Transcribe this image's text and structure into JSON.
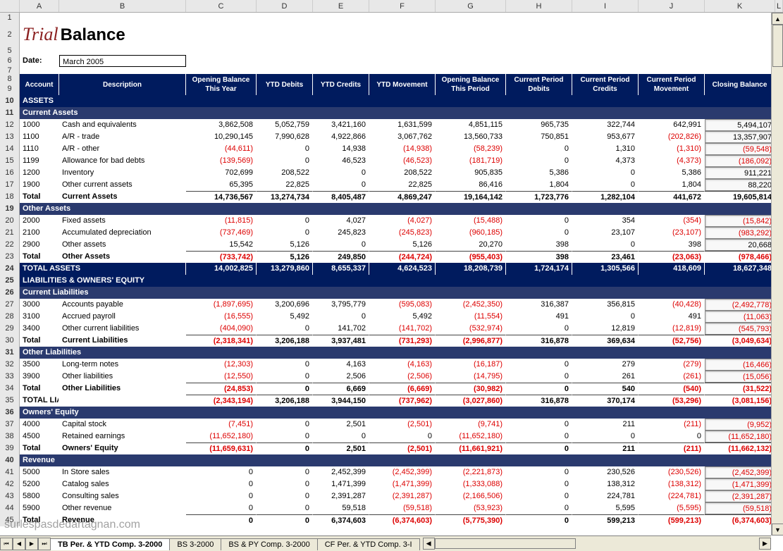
{
  "title": {
    "part1": "Trial",
    "part2": "Balance"
  },
  "date_label": "Date:",
  "date_value": "March 2005",
  "watermark": "surlespasdedartagnan.com",
  "col_letters": [
    "A",
    "B",
    "C",
    "D",
    "E",
    "F",
    "G",
    "H",
    "I",
    "J",
    "K",
    "L"
  ],
  "headers": [
    "Account",
    "Description",
    "Opening Balance This Year",
    "YTD Debits",
    "YTD Credits",
    "YTD Movement",
    "Opening Balance This Period",
    "Current Period Debits",
    "Current Period Credits",
    "Current Period Movement",
    "Closing Balance"
  ],
  "tabs": [
    "TB Per. & YTD Comp. 3-2000",
    "BS 3-2000",
    "BS & PY Comp. 3-2000",
    "CF Per. & YTD Comp. 3-I"
  ],
  "active_tab": 0,
  "sections": {
    "assets": "ASSETS",
    "current_assets": "Current Assets",
    "other_assets": "Other Assets",
    "total_assets": "TOTAL ASSETS",
    "liab_equity": "LIABILITIES & OWNERS' EQUITY",
    "current_liab": "Current Liabilities",
    "other_liab": "Other Liabilities",
    "total_liab": "TOTAL LIABILITIES",
    "owners_equity": "Owners' Equity",
    "revenue": "Revenue",
    "total_label": "Total"
  },
  "rows": [
    {
      "acct": "1000",
      "desc": "Cash and equivalents",
      "v": [
        "3,862,508",
        "5,052,759",
        "3,421,160",
        "1,631,599",
        "4,851,115",
        "965,735",
        "322,744",
        "642,991",
        "5,494,107"
      ],
      "neg": [
        0,
        0,
        0,
        0,
        0,
        0,
        0,
        0,
        0
      ],
      "box": true
    },
    {
      "acct": "1100",
      "desc": "A/R - trade",
      "v": [
        "10,290,145",
        "7,990,628",
        "4,922,866",
        "3,067,762",
        "13,560,733",
        "750,851",
        "953,677",
        "(202,826)",
        "13,357,907"
      ],
      "neg": [
        0,
        0,
        0,
        0,
        0,
        0,
        0,
        1,
        0
      ],
      "box": true
    },
    {
      "acct": "1110",
      "desc": "A/R - other",
      "v": [
        "(44,611)",
        "0",
        "14,938",
        "(14,938)",
        "(58,239)",
        "0",
        "1,310",
        "(1,310)",
        "(59,548)"
      ],
      "neg": [
        1,
        0,
        0,
        1,
        1,
        0,
        0,
        1,
        1
      ],
      "box": true
    },
    {
      "acct": "1199",
      "desc": "Allowance for bad debts",
      "v": [
        "(139,569)",
        "0",
        "46,523",
        "(46,523)",
        "(181,719)",
        "0",
        "4,373",
        "(4,373)",
        "(186,092)"
      ],
      "neg": [
        1,
        0,
        0,
        1,
        1,
        0,
        0,
        1,
        1
      ],
      "box": true
    },
    {
      "acct": "1200",
      "desc": "Inventory",
      "v": [
        "702,699",
        "208,522",
        "0",
        "208,522",
        "905,835",
        "5,386",
        "0",
        "5,386",
        "911,221"
      ],
      "neg": [
        0,
        0,
        0,
        0,
        0,
        0,
        0,
        0,
        0
      ],
      "box": true
    },
    {
      "acct": "1900",
      "desc": "Other current assets",
      "v": [
        "65,395",
        "22,825",
        "0",
        "22,825",
        "86,416",
        "1,804",
        "0",
        "1,804",
        "88,220"
      ],
      "neg": [
        0,
        0,
        0,
        0,
        0,
        0,
        0,
        0,
        0
      ],
      "box": true
    },
    {
      "acct": "Total",
      "desc": "Current Assets",
      "v": [
        "14,736,567",
        "13,274,734",
        "8,405,487",
        "4,869,247",
        "19,164,142",
        "1,723,776",
        "1,282,104",
        "441,672",
        "19,605,814"
      ],
      "neg": [
        0,
        0,
        0,
        0,
        0,
        0,
        0,
        0,
        0
      ],
      "bold": true,
      "bt": true
    },
    {
      "sub": "Other Assets"
    },
    {
      "acct": "2000",
      "desc": "Fixed assets",
      "v": [
        "(11,815)",
        "0",
        "4,027",
        "(4,027)",
        "(15,488)",
        "0",
        "354",
        "(354)",
        "(15,842)"
      ],
      "neg": [
        1,
        0,
        0,
        1,
        1,
        0,
        0,
        1,
        1
      ],
      "box": true
    },
    {
      "acct": "2100",
      "desc": "Accumulated depreciation",
      "v": [
        "(737,469)",
        "0",
        "245,823",
        "(245,823)",
        "(960,185)",
        "0",
        "23,107",
        "(23,107)",
        "(983,292)"
      ],
      "neg": [
        1,
        0,
        0,
        1,
        1,
        0,
        0,
        1,
        1
      ],
      "box": true
    },
    {
      "acct": "2900",
      "desc": "Other assets",
      "v": [
        "15,542",
        "5,126",
        "0",
        "5,126",
        "20,270",
        "398",
        "0",
        "398",
        "20,668"
      ],
      "neg": [
        0,
        0,
        0,
        0,
        0,
        0,
        0,
        0,
        0
      ],
      "box": true
    },
    {
      "acct": "Total",
      "desc": "Other Assets",
      "v": [
        "(733,742)",
        "5,126",
        "249,850",
        "(244,724)",
        "(955,403)",
        "398",
        "23,461",
        "(23,063)",
        "(978,466)"
      ],
      "neg": [
        1,
        0,
        0,
        1,
        1,
        0,
        0,
        1,
        1
      ],
      "bold": true,
      "bt": true
    },
    {
      "acct": "TOTAL ASSETS",
      "desc": "",
      "v": [
        "14,002,825",
        "13,279,860",
        "8,655,337",
        "4,624,523",
        "18,208,739",
        "1,724,174",
        "1,305,566",
        "418,609",
        "18,627,348"
      ],
      "neg": [
        0,
        0,
        0,
        0,
        0,
        0,
        0,
        0,
        0
      ],
      "dark": true
    },
    {
      "section": "LIABILITIES & OWNERS' EQUITY"
    },
    {
      "sub": "Current Liabilities"
    },
    {
      "acct": "3000",
      "desc": "Accounts payable",
      "v": [
        "(1,897,695)",
        "3,200,696",
        "3,795,779",
        "(595,083)",
        "(2,452,350)",
        "316,387",
        "356,815",
        "(40,428)",
        "(2,492,778)"
      ],
      "neg": [
        1,
        0,
        0,
        1,
        1,
        0,
        0,
        1,
        1
      ],
      "box": true
    },
    {
      "acct": "3100",
      "desc": "Accrued payroll",
      "v": [
        "(16,555)",
        "5,492",
        "0",
        "5,492",
        "(11,554)",
        "491",
        "0",
        "491",
        "(11,063)"
      ],
      "neg": [
        1,
        0,
        0,
        0,
        1,
        0,
        0,
        0,
        1
      ],
      "box": true
    },
    {
      "acct": "3400",
      "desc": "Other current liabilities",
      "v": [
        "(404,090)",
        "0",
        "141,702",
        "(141,702)",
        "(532,974)",
        "0",
        "12,819",
        "(12,819)",
        "(545,793)"
      ],
      "neg": [
        1,
        0,
        0,
        1,
        1,
        0,
        0,
        1,
        1
      ],
      "box": true
    },
    {
      "acct": "Total",
      "desc": "Current Liabilities",
      "v": [
        "(2,318,341)",
        "3,206,188",
        "3,937,481",
        "(731,293)",
        "(2,996,877)",
        "316,878",
        "369,634",
        "(52,756)",
        "(3,049,634)"
      ],
      "neg": [
        1,
        0,
        0,
        1,
        1,
        0,
        0,
        1,
        1
      ],
      "bold": true,
      "bt": true
    },
    {
      "sub": "Other Liabilities"
    },
    {
      "acct": "3500",
      "desc": "Long-term notes",
      "v": [
        "(12,303)",
        "0",
        "4,163",
        "(4,163)",
        "(16,187)",
        "0",
        "279",
        "(279)",
        "(16,466)"
      ],
      "neg": [
        1,
        0,
        0,
        1,
        1,
        0,
        0,
        1,
        1
      ],
      "box": true
    },
    {
      "acct": "3900",
      "desc": "Other liabilities",
      "v": [
        "(12,550)",
        "0",
        "2,506",
        "(2,506)",
        "(14,795)",
        "0",
        "261",
        "(261)",
        "(15,056)"
      ],
      "neg": [
        1,
        0,
        0,
        1,
        1,
        0,
        0,
        1,
        1
      ],
      "box": true
    },
    {
      "acct": "Total",
      "desc": "Other Liabilities",
      "v": [
        "(24,853)",
        "0",
        "6,669",
        "(6,669)",
        "(30,982)",
        "0",
        "540",
        "(540)",
        "(31,522)"
      ],
      "neg": [
        1,
        0,
        0,
        1,
        1,
        0,
        0,
        1,
        1
      ],
      "bold": true,
      "bt": true
    },
    {
      "acct": "TOTAL LIABILITIES",
      "desc": "",
      "v": [
        "(2,343,194)",
        "3,206,188",
        "3,944,150",
        "(737,962)",
        "(3,027,860)",
        "316,878",
        "370,174",
        "(53,296)",
        "(3,081,156)"
      ],
      "neg": [
        1,
        0,
        0,
        1,
        1,
        0,
        0,
        1,
        1
      ],
      "bold": true,
      "bt": true
    },
    {
      "sub": "Owners' Equity"
    },
    {
      "acct": "4000",
      "desc": "Capital stock",
      "v": [
        "(7,451)",
        "0",
        "2,501",
        "(2,501)",
        "(9,741)",
        "0",
        "211",
        "(211)",
        "(9,952)"
      ],
      "neg": [
        1,
        0,
        0,
        1,
        1,
        0,
        0,
        1,
        1
      ],
      "box": true
    },
    {
      "acct": "4500",
      "desc": "Retained earnings",
      "v": [
        "(11,652,180)",
        "0",
        "0",
        "0",
        "(11,652,180)",
        "0",
        "0",
        "0",
        "(11,652,180)"
      ],
      "neg": [
        1,
        0,
        0,
        0,
        1,
        0,
        0,
        0,
        1
      ],
      "box": true
    },
    {
      "acct": "Total",
      "desc": "Owners' Equity",
      "v": [
        "(11,659,631)",
        "0",
        "2,501",
        "(2,501)",
        "(11,661,921)",
        "0",
        "211",
        "(211)",
        "(11,662,132)"
      ],
      "neg": [
        1,
        0,
        0,
        1,
        1,
        0,
        0,
        1,
        1
      ],
      "bold": true,
      "bt": true
    },
    {
      "sub": "Revenue"
    },
    {
      "acct": "5000",
      "desc": "In Store sales",
      "v": [
        "0",
        "0",
        "2,452,399",
        "(2,452,399)",
        "(2,221,873)",
        "0",
        "230,526",
        "(230,526)",
        "(2,452,399)"
      ],
      "neg": [
        0,
        0,
        0,
        1,
        1,
        0,
        0,
        1,
        1
      ],
      "box": true
    },
    {
      "acct": "5200",
      "desc": "Catalog sales",
      "v": [
        "0",
        "0",
        "1,471,399",
        "(1,471,399)",
        "(1,333,088)",
        "0",
        "138,312",
        "(138,312)",
        "(1,471,399)"
      ],
      "neg": [
        0,
        0,
        0,
        1,
        1,
        0,
        0,
        1,
        1
      ],
      "box": true
    },
    {
      "acct": "5800",
      "desc": "Consulting sales",
      "v": [
        "0",
        "0",
        "2,391,287",
        "(2,391,287)",
        "(2,166,506)",
        "0",
        "224,781",
        "(224,781)",
        "(2,391,287)"
      ],
      "neg": [
        0,
        0,
        0,
        1,
        1,
        0,
        0,
        1,
        1
      ],
      "box": true
    },
    {
      "acct": "5900",
      "desc": "Other revenue",
      "v": [
        "0",
        "0",
        "59,518",
        "(59,518)",
        "(53,923)",
        "0",
        "5,595",
        "(5,595)",
        "(59,518)"
      ],
      "neg": [
        0,
        0,
        0,
        1,
        1,
        0,
        0,
        1,
        1
      ],
      "box": true
    },
    {
      "acct": "Total",
      "desc": "Revenue",
      "v": [
        "0",
        "0",
        "6,374,603",
        "(6,374,603)",
        "(5,775,390)",
        "0",
        "599,213",
        "(599,213)",
        "(6,374,603)"
      ],
      "neg": [
        0,
        0,
        0,
        1,
        1,
        0,
        0,
        1,
        1
      ],
      "bold": true,
      "bt": true
    }
  ]
}
